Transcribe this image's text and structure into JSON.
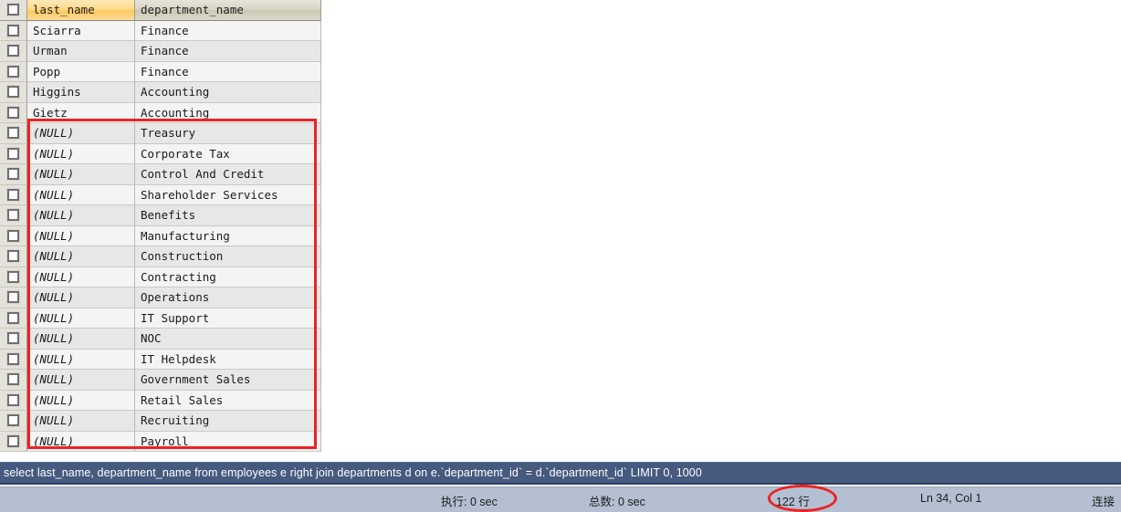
{
  "grid": {
    "columns": [
      {
        "key": "last_name",
        "label": "last_name",
        "selected": true
      },
      {
        "key": "department_name",
        "label": "department_name",
        "selected": false
      }
    ],
    "rows": [
      {
        "last_name": "Sciarra",
        "department_name": "Finance",
        "is_null": false
      },
      {
        "last_name": "Urman",
        "department_name": "Finance",
        "is_null": false
      },
      {
        "last_name": "Popp",
        "department_name": "Finance",
        "is_null": false
      },
      {
        "last_name": "Higgins",
        "department_name": "Accounting",
        "is_null": false
      },
      {
        "last_name": "Gietz",
        "department_name": "Accounting",
        "is_null": false
      },
      {
        "last_name": "(NULL)",
        "department_name": "Treasury",
        "is_null": true
      },
      {
        "last_name": "(NULL)",
        "department_name": "Corporate Tax",
        "is_null": true
      },
      {
        "last_name": "(NULL)",
        "department_name": "Control And Credit",
        "is_null": true
      },
      {
        "last_name": "(NULL)",
        "department_name": "Shareholder Services",
        "is_null": true
      },
      {
        "last_name": "(NULL)",
        "department_name": "Benefits",
        "is_null": true
      },
      {
        "last_name": "(NULL)",
        "department_name": "Manufacturing",
        "is_null": true
      },
      {
        "last_name": "(NULL)",
        "department_name": "Construction",
        "is_null": true
      },
      {
        "last_name": "(NULL)",
        "department_name": "Contracting",
        "is_null": true
      },
      {
        "last_name": "(NULL)",
        "department_name": "Operations",
        "is_null": true
      },
      {
        "last_name": "(NULL)",
        "department_name": "IT Support",
        "is_null": true
      },
      {
        "last_name": "(NULL)",
        "department_name": "NOC",
        "is_null": true
      },
      {
        "last_name": "(NULL)",
        "department_name": "IT Helpdesk",
        "is_null": true
      },
      {
        "last_name": "(NULL)",
        "department_name": "Government Sales",
        "is_null": true
      },
      {
        "last_name": "(NULL)",
        "department_name": "Retail Sales",
        "is_null": true
      },
      {
        "last_name": "(NULL)",
        "department_name": "Recruiting",
        "is_null": true
      },
      {
        "last_name": "(NULL)",
        "department_name": "Payroll",
        "is_null": true
      }
    ]
  },
  "sql": {
    "query": "select last_name, department_name from employees e right join departments d on e.`department_id` = d.`department_id` LIMIT 0, 1000"
  },
  "status": {
    "exec_time": "执行: 0 sec",
    "total_time": "总数: 0 sec",
    "row_count": "122 行",
    "cursor_pos": "Ln 34, Col 1",
    "connection": "连接"
  },
  "annotations": {
    "color": "#ee2222",
    "rect_label": "null-rows-highlight",
    "ellipse_label": "row-count-highlight"
  }
}
